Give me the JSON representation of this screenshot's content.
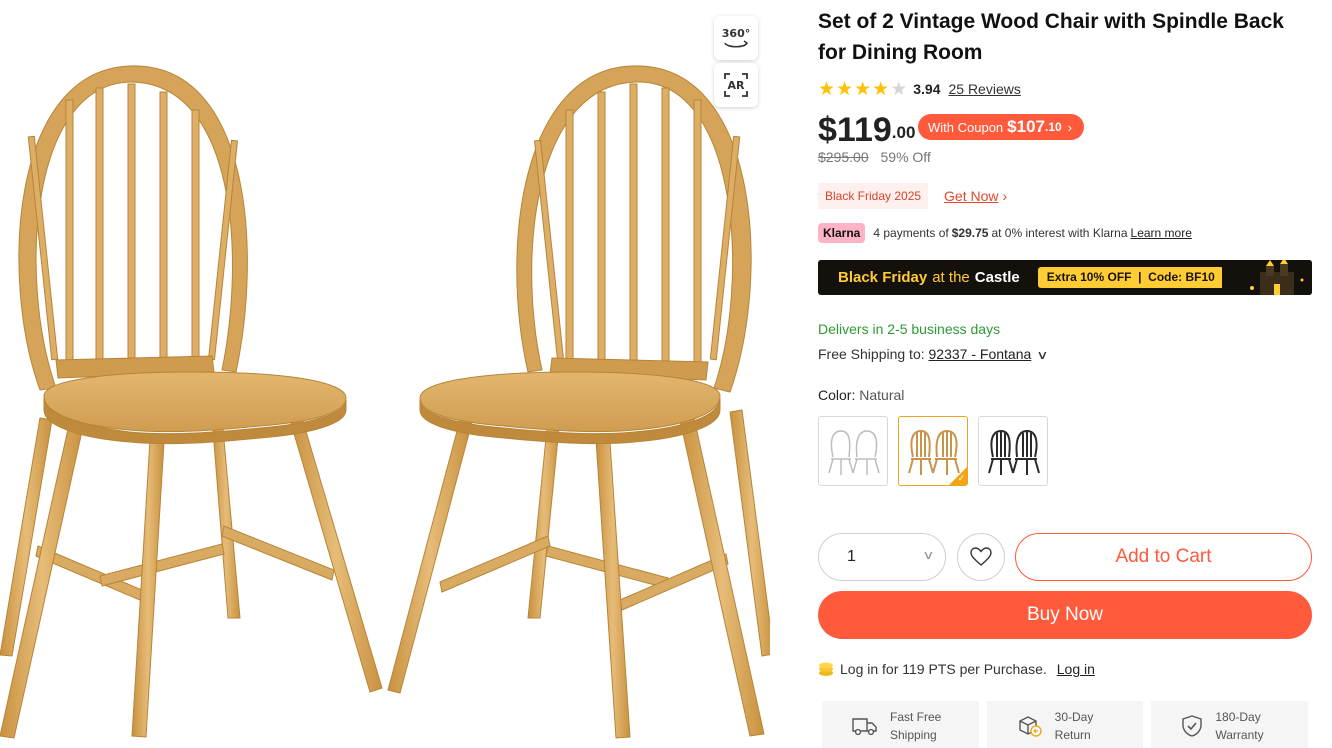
{
  "gallery": {
    "btn_360_label": "360°",
    "btn_ar_label": "AR"
  },
  "product": {
    "title": "Set of 2 Vintage Wood Chair with Spindle Back for Dining Room",
    "rating": 3.94,
    "rating_text": "3.94",
    "reviews_link": "25 Reviews",
    "price_whole": "$119",
    "price_cents": ".00",
    "coupon_prefix": "With Coupon",
    "coupon_price": "$107",
    "coupon_cents": ".10",
    "original_price": "$295.00",
    "discount": "59% Off"
  },
  "promo": {
    "tag": "Black Friday 2025",
    "link": "Get Now"
  },
  "klarna": {
    "badge": "Klarna",
    "text_before": "4 payments of",
    "amount": "$29.75",
    "text_after": "at 0% interest with Klarna",
    "learn_more": "Learn more"
  },
  "banner": {
    "word1": "Black Friday",
    "word2": "at the",
    "word3": "Castle",
    "code_text": "Extra 10% OFF  |  Code: BF10"
  },
  "shipping": {
    "delivers": "Delivers in 2-5 business days",
    "label": "Free Shipping to:",
    "location": "92337 - Fontana"
  },
  "color": {
    "label": "Color:",
    "selected": "Natural",
    "options": [
      {
        "name": "White",
        "hex": "#f2f2f2"
      },
      {
        "name": "Natural",
        "hex": "#d6a55c"
      },
      {
        "name": "Black",
        "hex": "#2a2a2a"
      }
    ]
  },
  "purchase": {
    "quantity": "1",
    "add_to_cart": "Add to Cart",
    "buy_now": "Buy Now",
    "points_text": "Log in for 119 PTS per Purchase.",
    "login_link": "Log in"
  },
  "perks": [
    {
      "line1": "Fast Free",
      "line2": "Shipping",
      "icon": "truck-icon"
    },
    {
      "line1": "30-Day",
      "line2": "Return",
      "icon": "return-box-icon"
    },
    {
      "line1": "180-Day",
      "line2": "Warranty",
      "icon": "shield-check-icon"
    }
  ],
  "colors": {
    "accent": "#ff5a3c",
    "star": "#ffc107",
    "green": "#2e9a33",
    "banner_bg": "#14110d",
    "banner_yellow": "#ffcc33",
    "wood": "#d9ad6a"
  }
}
